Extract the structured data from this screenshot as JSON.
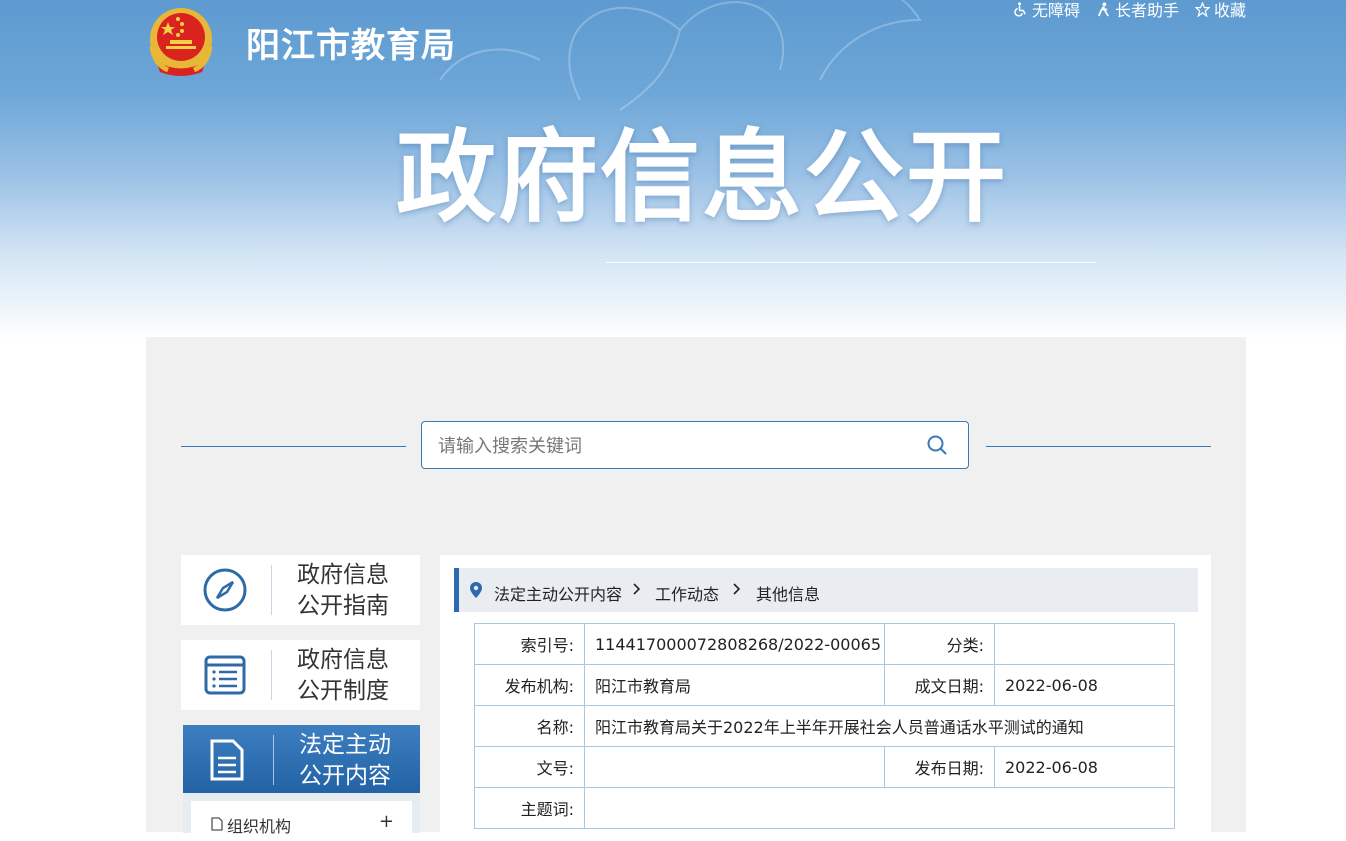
{
  "header": {
    "site_name": "阳江市教育局",
    "page_title": "政府信息公开",
    "tools": [
      {
        "label": "无障碍",
        "icon": "wheelchair-icon"
      },
      {
        "label": "长者助手",
        "icon": "elder-icon"
      },
      {
        "label": "收藏",
        "icon": "star-icon"
      }
    ]
  },
  "search": {
    "placeholder": "请输入搜索关键词"
  },
  "sidebar": {
    "items": [
      {
        "line1": "政府信息",
        "line2": "公开指南",
        "icon": "compass-icon",
        "active": false
      },
      {
        "line1": "政府信息",
        "line2": "公开制度",
        "icon": "list-doc-icon",
        "active": false
      },
      {
        "line1": "法定主动",
        "line2": "公开内容",
        "icon": "document-icon",
        "active": true
      }
    ],
    "sub_items": [
      {
        "label": "组织机构",
        "expander": "+"
      }
    ]
  },
  "breadcrumb": [
    "法定主动公开内容",
    "工作动态",
    "其他信息"
  ],
  "info": {
    "index_no_label": "索引号:",
    "index_no": "114417000072808268/2022-00065",
    "category_label": "分类:",
    "category": "",
    "publisher_label": "发布机构:",
    "publisher": "阳江市教育局",
    "created_label": "成文日期:",
    "created": "2022-06-08",
    "name_label": "名称:",
    "name": "阳江市教育局关于2022年上半年开展社会人员普通话水平测试的通知",
    "doc_no_label": "文号:",
    "doc_no": "",
    "published_label": "发布日期:",
    "published": "2022-06-08",
    "subject_label": "主题词:",
    "subject": ""
  }
}
